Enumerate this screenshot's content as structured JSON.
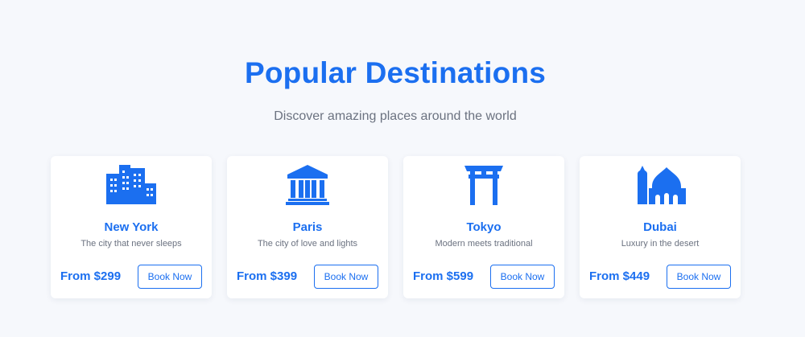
{
  "section": {
    "title": "Popular Destinations",
    "subtitle": "Discover amazing places around the world"
  },
  "accent_color": "#1b6ff0",
  "destinations": [
    {
      "name": "New York",
      "description": "The city that never sleeps",
      "price": "From $299",
      "button": "Book Now",
      "icon": "city-buildings-icon"
    },
    {
      "name": "Paris",
      "description": "The city of love and lights",
      "price": "From $399",
      "button": "Book Now",
      "icon": "landmark-columns-icon"
    },
    {
      "name": "Tokyo",
      "description": "Modern meets traditional",
      "price": "From $599",
      "button": "Book Now",
      "icon": "torii-gate-icon"
    },
    {
      "name": "Dubai",
      "description": "Luxury in the desert",
      "price": "From $449",
      "button": "Book Now",
      "icon": "mosque-icon"
    }
  ]
}
